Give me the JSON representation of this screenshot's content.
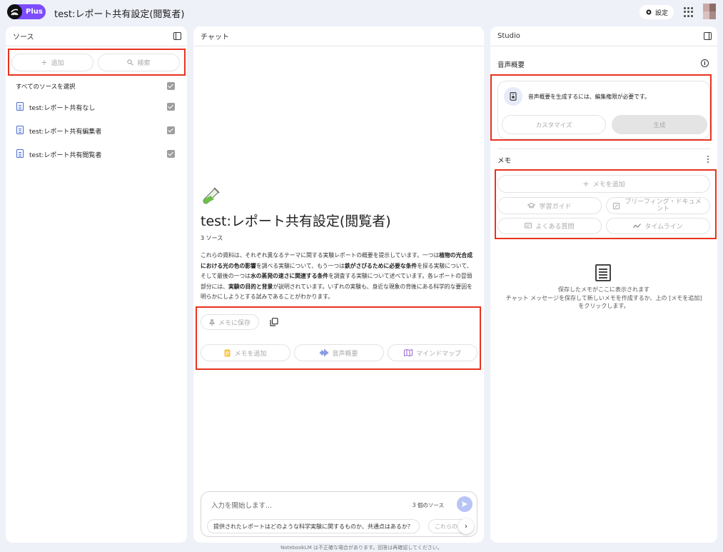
{
  "header": {
    "logo_badge": "Plus",
    "notebook_title": "test:レポート共有設定(閲覧者)",
    "settings_label": "設定"
  },
  "sources": {
    "title": "ソース",
    "add_label": "追加",
    "search_label": "検索",
    "select_all_label": "すべてのソースを選択",
    "items": [
      {
        "label": "test:レポート共有なし"
      },
      {
        "label": "test:レポート共有編集者"
      },
      {
        "label": "test:レポート共有閲覧者"
      }
    ]
  },
  "chat": {
    "title": "チャット",
    "notebook_title": "test:レポート共有設定(閲覧者)",
    "source_count": "3 ソース",
    "summary_parts": [
      {
        "t": "これらの資料は、それぞれ異なるテーマに関する実験レポートの概要を提示しています。一つは",
        "b": false
      },
      {
        "t": "植物の光合成における光の色の影響",
        "b": true
      },
      {
        "t": "を調べる実験について、もう一つは",
        "b": false
      },
      {
        "t": "鉄がさびるために必要な条件",
        "b": true
      },
      {
        "t": "を探る実験について、そして最後の一つは",
        "b": false
      },
      {
        "t": "水の蒸発の速さに関連する条件",
        "b": true
      },
      {
        "t": "を調査する実験について述べています。各レポートの冒頭部分には、",
        "b": false
      },
      {
        "t": "実験の目的と背景",
        "b": true
      },
      {
        "t": "が説明されています。いずれの実験も、身近な現象の背後にある科学的な要因を明らかにしようとする試みであることがわかります。",
        "b": false
      }
    ],
    "save_to_memo": "メモに保存",
    "add_memo": "メモを追加",
    "audio_overview": "音声概要",
    "mind_map": "マインドマップ",
    "input_placeholder": "入力を開始します...",
    "input_source_count": "3 個のソース",
    "suggestion_1": "提供されたレポートはどのような科学実験に関するものか、共通点はあるか？",
    "suggestion_2": "これらの"
  },
  "studio": {
    "title": "Studio",
    "audio_title": "音声概要",
    "audio_message": "音声概要を生成するには、編集権限が必要です。",
    "customize_label": "カスタマイズ",
    "generate_label": "生成",
    "memo_title": "メモ",
    "add_memo": "メモを追加",
    "study_guide": "学習ガイド",
    "briefing_doc": "ブリーフィング・ドキュメント",
    "faq": "よくある質問",
    "timeline": "タイムライン",
    "empty_line1": "保存したメモがここに表示されます",
    "empty_line2": "チャット メッセージを保存して新しいメモを作成するか、上の [メモを追加]",
    "empty_line3": "をクリックします。"
  },
  "footer": {
    "disclaimer": "NotebookLM は不正確な場合があります。回答は再確認してください。"
  },
  "colors": {
    "accent_purple": "#7c4dff",
    "highlight_red": "#e8321f",
    "background": "#eef1f8"
  }
}
